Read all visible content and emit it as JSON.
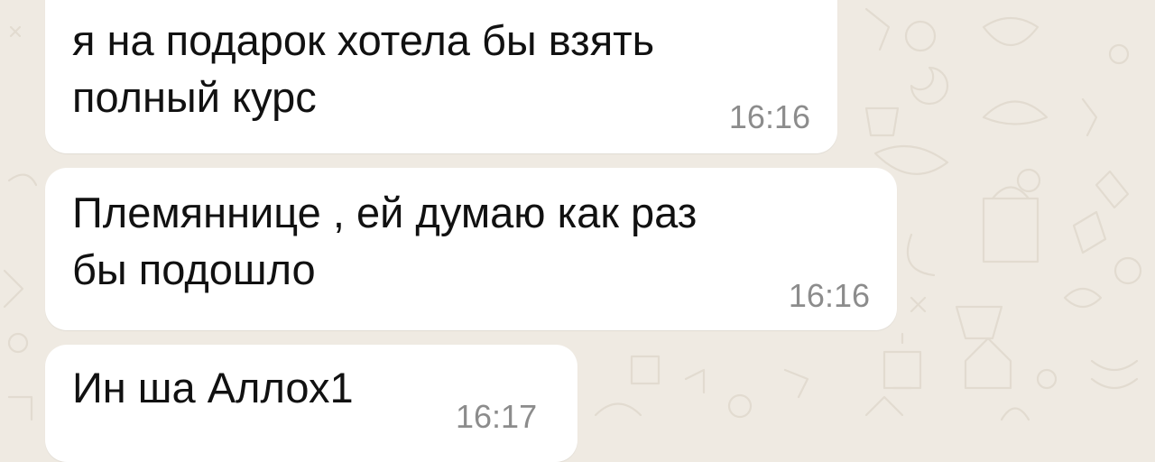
{
  "chat": {
    "messages": [
      {
        "text": "я на подарок хотела бы взять\nполный курс",
        "time": "16:16"
      },
      {
        "text": "Племяннице , ей думаю как раз\nбы подошло",
        "time": "16:16"
      },
      {
        "text": "Ин ша Аллох1",
        "time": "16:17"
      }
    ]
  },
  "colors": {
    "wallpaper": "#efeae2",
    "bubble": "#ffffff",
    "text": "#111111",
    "time": "#8c8c8c"
  }
}
